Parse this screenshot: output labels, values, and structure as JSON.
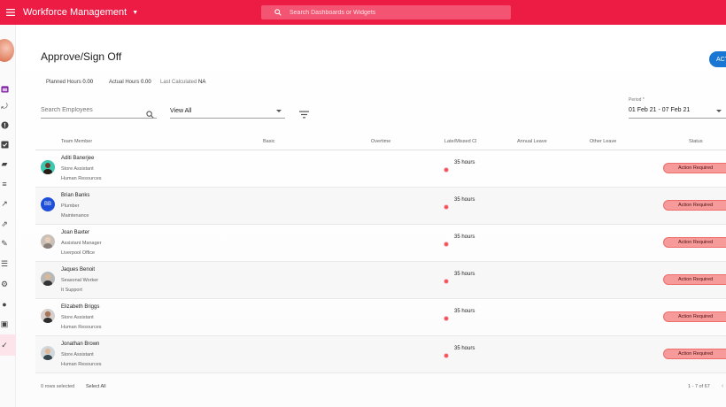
{
  "topbar": {
    "title": "Workforce Management",
    "search_placeholder": "Search Dashboards or Widgets"
  },
  "page": {
    "title": "Approve/Sign Off",
    "action_label": "ACT",
    "planned_label": "Planned Hours",
    "planned_value": "0.00",
    "actual_label": "Actual Hours",
    "actual_value": "0.00",
    "lastcalc_label": "Last Calculated",
    "lastcalc_value": "NA"
  },
  "filters": {
    "employee_search_placeholder": "Search Employees",
    "view_value": "View All",
    "period_label": "Period *",
    "period_value": "01 Feb 21 - 07 Feb 21"
  },
  "table": {
    "headers": [
      "Team Member",
      "Basic",
      "Overtime",
      "Late/Missed Cl",
      "Annual Leave",
      "Other Leave",
      "Status"
    ],
    "rows": [
      {
        "name": "Aditi Banerjee",
        "role": "Store Assistant",
        "dept": "Human Resources",
        "late": "35 hours",
        "status": "Action Required"
      },
      {
        "name": "Brian Banks",
        "role": "Plumber",
        "dept": "Maintenance",
        "late": "35 hours",
        "status": "Action Required",
        "initials": "BB"
      },
      {
        "name": "Joan Baxter",
        "role": "Assistant Manager",
        "dept": "Liverpool Office",
        "late": "35 hours",
        "status": "Action Required"
      },
      {
        "name": "Jaques Benoit",
        "role": "Seasonal Worker",
        "dept": "It Support",
        "late": "35 hours",
        "status": "Action Required"
      },
      {
        "name": "Elizabeth Briggs",
        "role": "Store Assistant",
        "dept": "Human Resources",
        "late": "35 hours",
        "status": "Action Required"
      },
      {
        "name": "Jonathan Brown",
        "role": "Store Assistant",
        "dept": "Human Resources",
        "late": "35 hours",
        "status": "Action Required"
      }
    ]
  },
  "footer": {
    "selected": "0 rows selected",
    "select_all": "Select All",
    "pager": "1 - 7 of 67"
  },
  "colors": {
    "brand": "#ec1c45",
    "status_fill": "#f79a9a",
    "accent_button": "#1976d2"
  }
}
